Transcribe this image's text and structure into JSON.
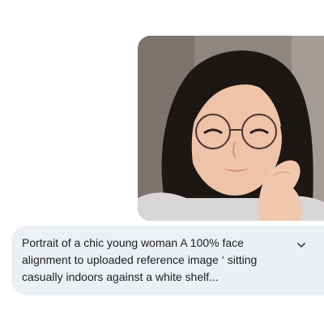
{
  "chat": {
    "uploaded_image": {
      "icon": "portrait-photo"
    },
    "prompt": {
      "text": "Portrait of a chic young woman A 100% face alignment to uploaded reference image ‘ sitting casually indoors against a white shelf...",
      "expand_icon": "chevron-down-icon"
    }
  },
  "colors": {
    "bubble_background": "#eceff3",
    "text": "#1f1f1f",
    "page_background": "#ffffff"
  }
}
